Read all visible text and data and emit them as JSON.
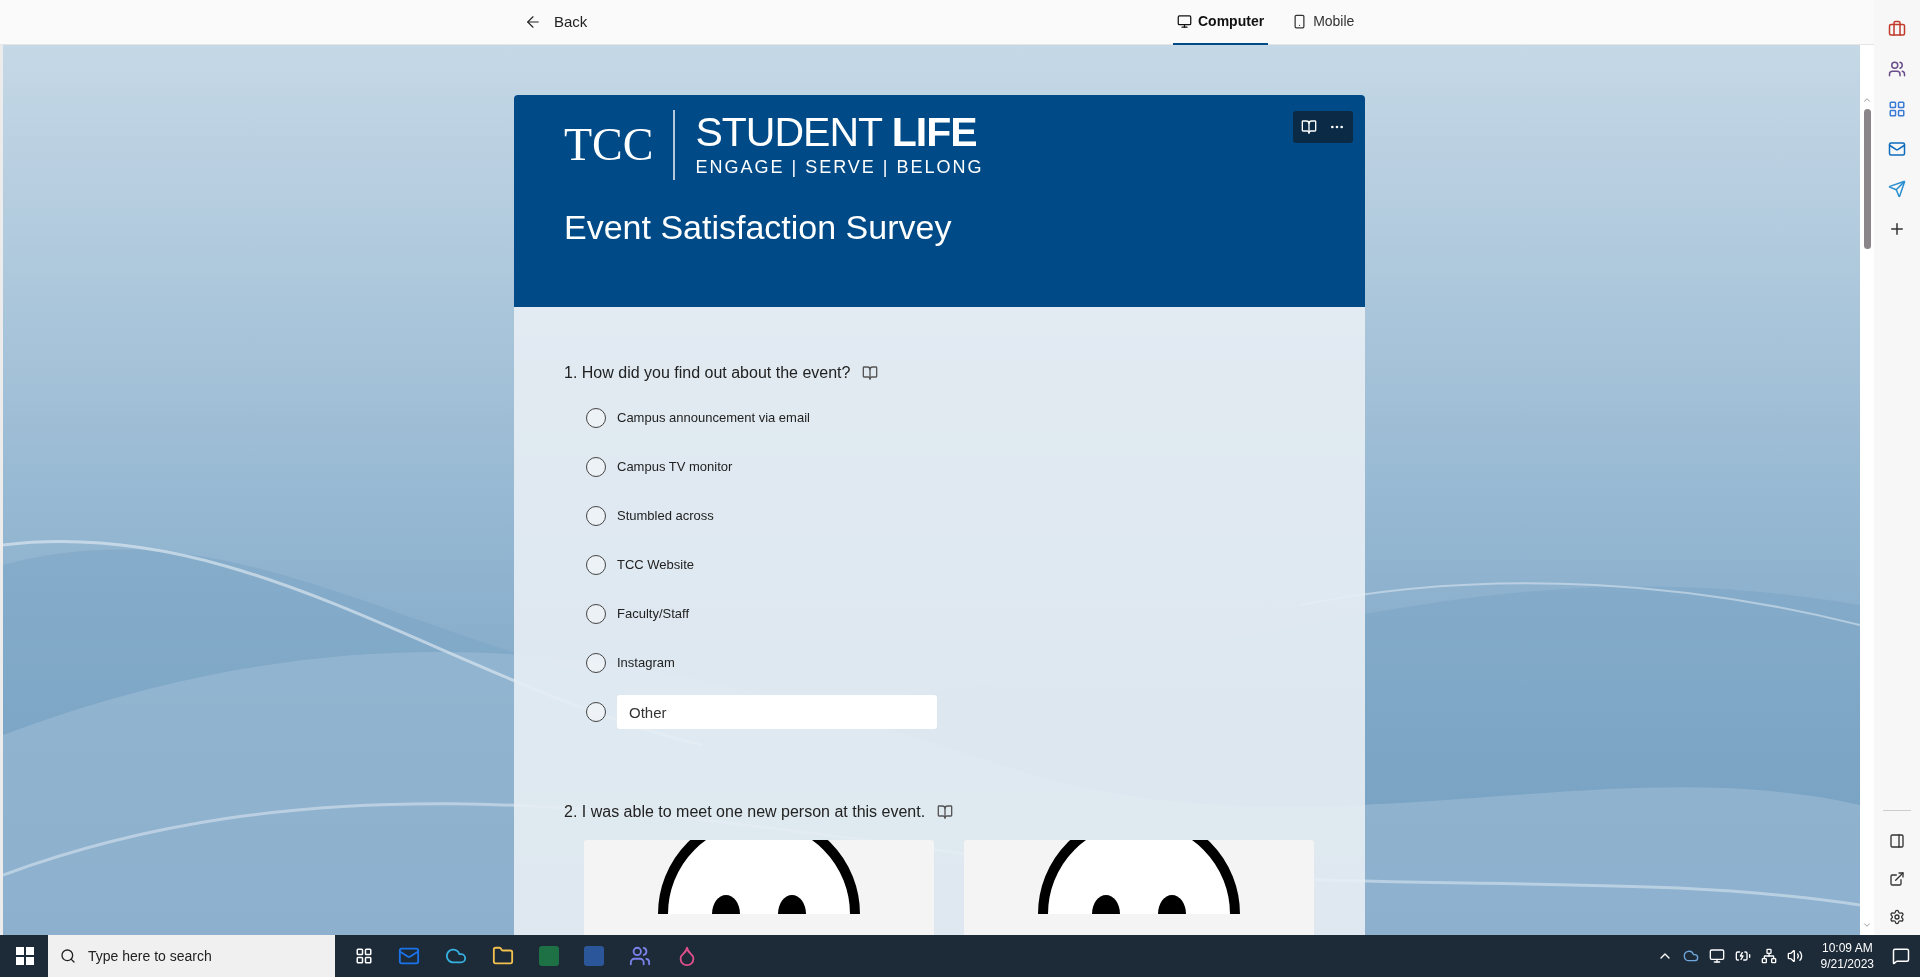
{
  "top_bar": {
    "back": "Back",
    "view_tabs": [
      {
        "label": "Computer",
        "kind": "computer",
        "selected": true
      },
      {
        "label": "Mobile",
        "kind": "mobile",
        "selected": false
      }
    ]
  },
  "form": {
    "logo": {
      "monogram": "TCC",
      "title": "STUDENT **LIFE**",
      "tagline": "ENGAGE | SERVE | BELONG"
    },
    "title": "Event Satisfaction Survey",
    "questions": [
      {
        "number": "1.",
        "text": "How did you find out about the event?",
        "kind": "choice",
        "options": [
          {
            "label": "Campus announcement via email",
            "selected": false
          },
          {
            "label": "Campus TV monitor",
            "selected": false
          },
          {
            "label": "Stumbled across",
            "selected": false
          },
          {
            "label": "TCC Website",
            "selected": false
          },
          {
            "label": "Faculty/Staff",
            "selected": false
          },
          {
            "label": "Instagram",
            "selected": false
          }
        ],
        "other": {
          "placeholder": "Other",
          "selected": false
        }
      },
      {
        "number": "2.",
        "text": "I was able to meet one new person at this event.",
        "kind": "image_choice",
        "options": [
          {
            "selected": false
          },
          {
            "selected": false
          }
        ]
      }
    ]
  },
  "taskbar": {
    "search": {
      "placeholder": "Type here to search"
    },
    "time": "10:09 AM",
    "date": "9/21/2023"
  }
}
